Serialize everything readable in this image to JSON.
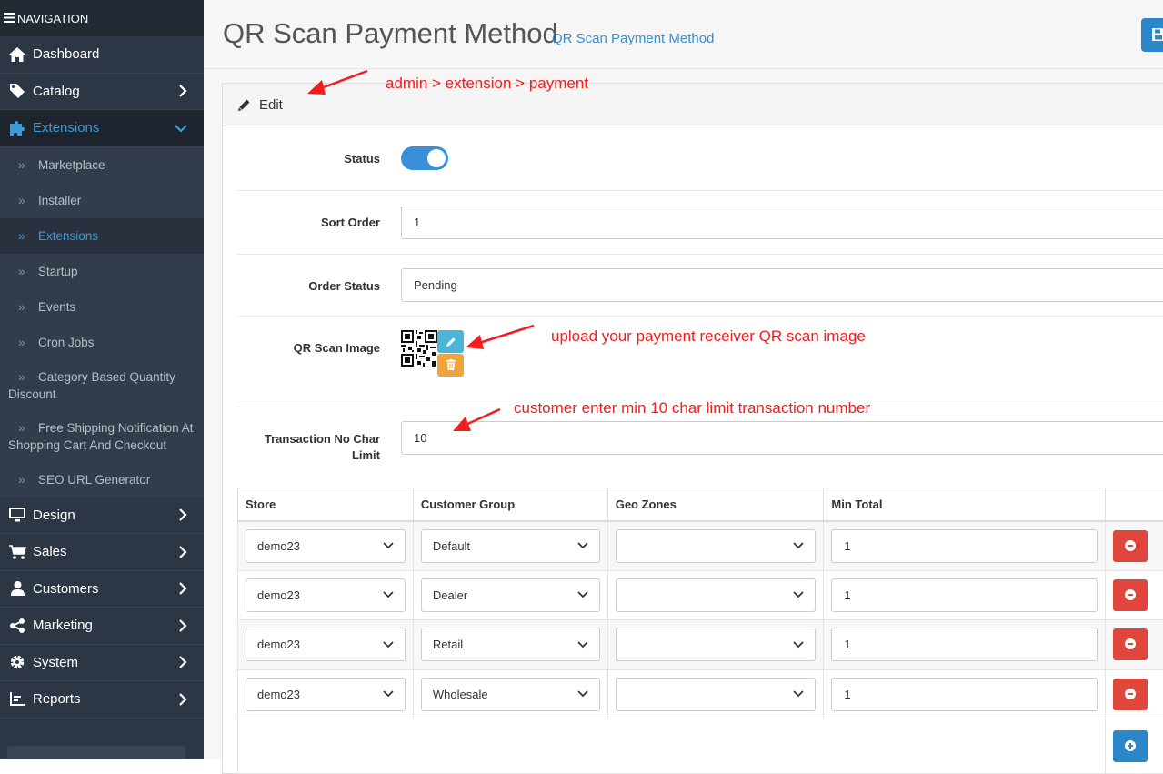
{
  "sidebar": {
    "header": "NAVIGATION",
    "items": [
      {
        "label": "Dashboard",
        "icon": "home-icon"
      },
      {
        "label": "Catalog",
        "icon": "tag-icon"
      },
      {
        "label": "Extensions",
        "icon": "puzzle-icon",
        "expanded": true
      },
      {
        "label": "Design",
        "icon": "monitor-icon"
      },
      {
        "label": "Sales",
        "icon": "cart-icon"
      },
      {
        "label": "Customers",
        "icon": "user-icon"
      },
      {
        "label": "Marketing",
        "icon": "share-icon"
      },
      {
        "label": "System",
        "icon": "gear-icon"
      },
      {
        "label": "Reports",
        "icon": "bar-chart-icon"
      }
    ],
    "subitems": [
      "Marketplace",
      "Installer",
      "Extensions",
      "Startup",
      "Events",
      "Cron Jobs",
      "Category Based Quantity Discount",
      "Free Shipping Notification At Shopping Cart And Checkout",
      "SEO URL Generator"
    ],
    "active_subitem": "Extensions"
  },
  "header": {
    "title": "QR Scan Payment Method",
    "breadcrumb": "QR Scan Payment Method"
  },
  "panel": {
    "heading": "Edit"
  },
  "form": {
    "status_label": "Status",
    "status_on": true,
    "sort_order_label": "Sort Order",
    "sort_order_value": "1",
    "order_status_label": "Order Status",
    "order_status_value": "Pending",
    "qr_image_label": "QR Scan Image",
    "char_limit_label": "Transaction No Char Limit",
    "char_limit_value": "10"
  },
  "table": {
    "headers": [
      "Store",
      "Customer Group",
      "Geo Zones",
      "Min Total"
    ],
    "rows": [
      {
        "store": "demo23",
        "group": "Default",
        "geo": "",
        "min_total": "1"
      },
      {
        "store": "demo23",
        "group": "Dealer",
        "geo": "",
        "min_total": "1"
      },
      {
        "store": "demo23",
        "group": "Retail",
        "geo": "",
        "min_total": "1"
      },
      {
        "store": "demo23",
        "group": "Wholesale",
        "geo": "",
        "min_total": "1"
      }
    ]
  },
  "annotations": {
    "path_note": "admin > extension > payment",
    "upload_note": "upload your payment receiver QR scan image",
    "char_note": "customer enter min 10 char limit transaction number"
  },
  "colors": {
    "sidebar_bg": "#2d3644",
    "accent_blue": "#3a8fcd",
    "annotation_red": "#f41c1c",
    "danger": "#e0463b",
    "warning": "#f0a53a",
    "info": "#4cb5d6"
  }
}
